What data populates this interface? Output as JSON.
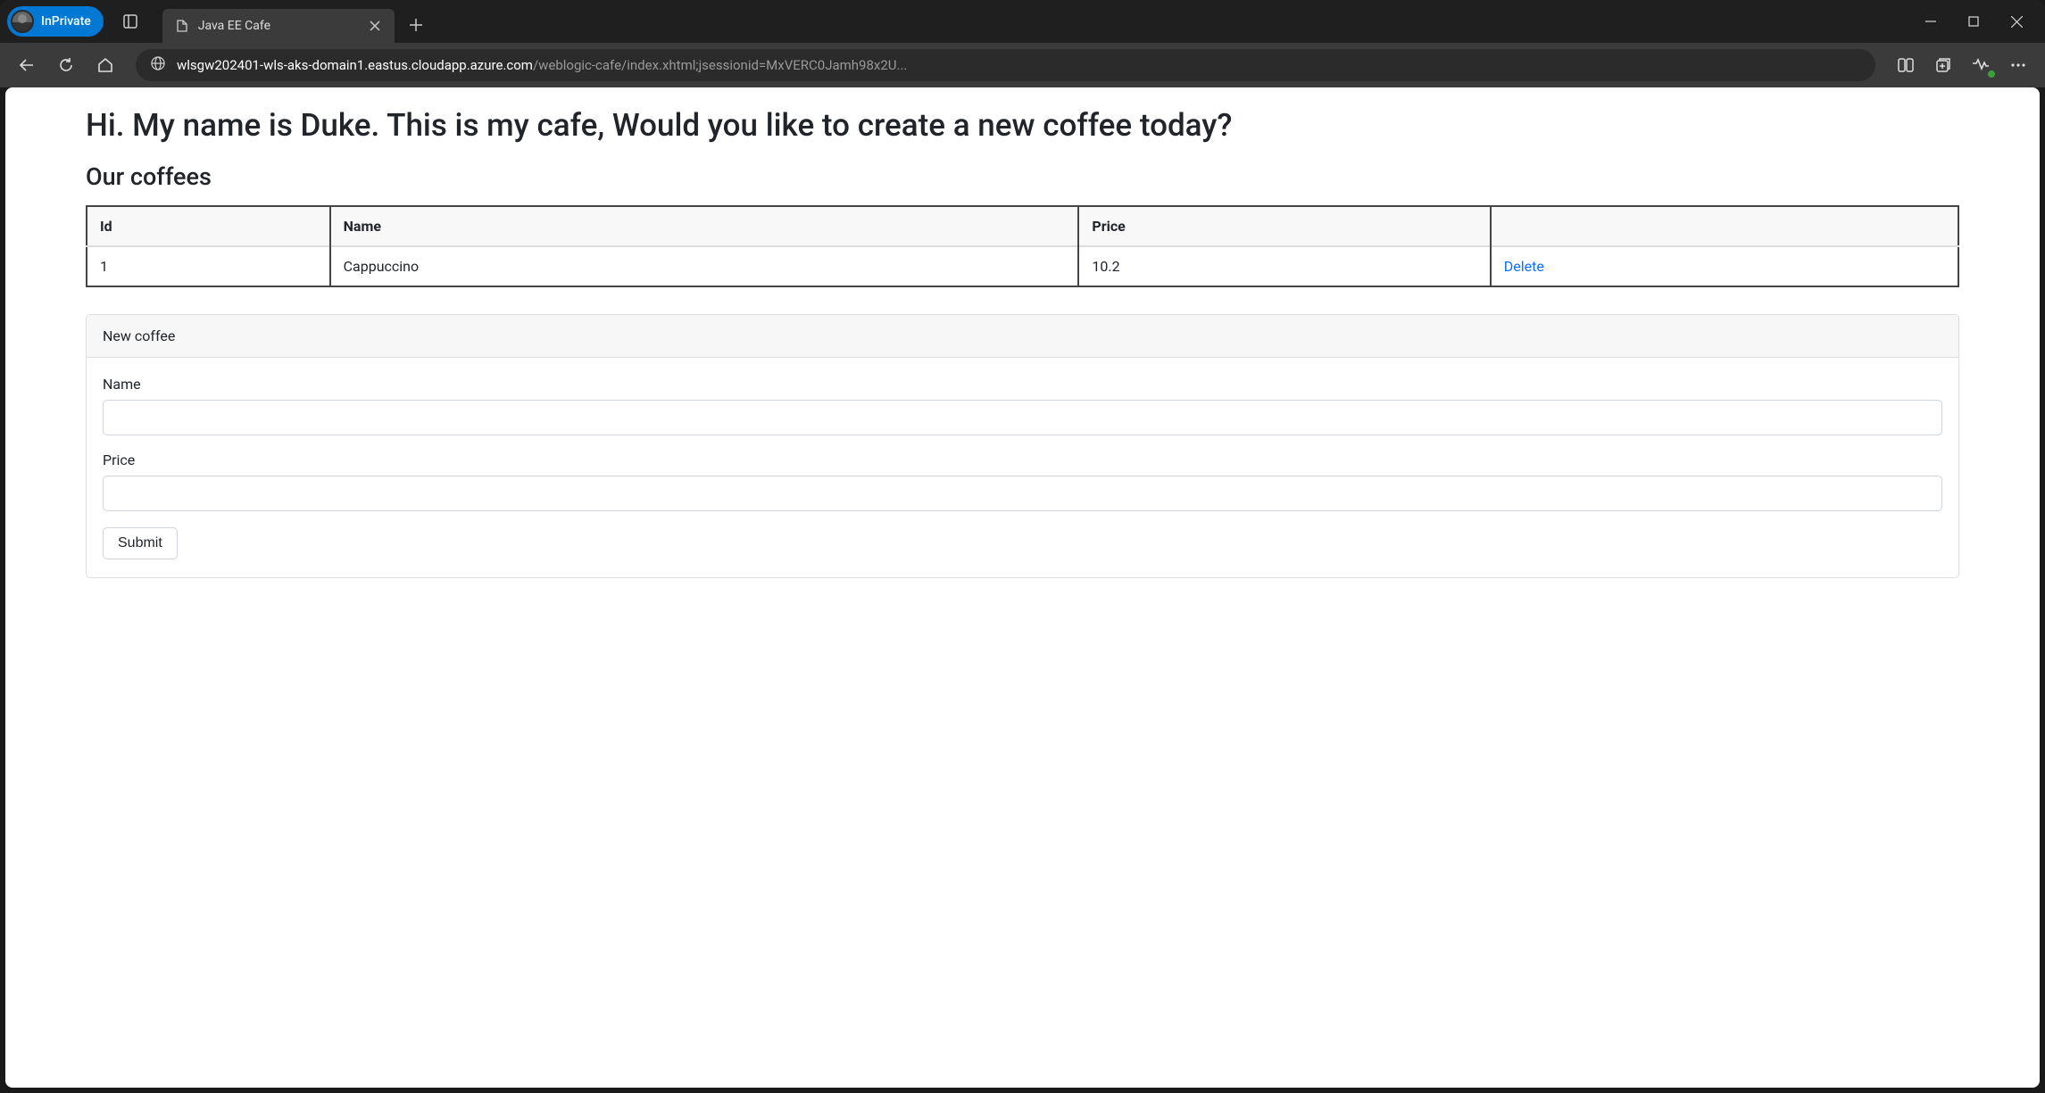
{
  "browser": {
    "inprivate_label": "InPrivate",
    "tab_title": "Java EE Cafe",
    "url_host": "wlsgw202401-wls-aks-domain1.eastus.cloudapp.azure.com",
    "url_path": "/weblogic-cafe/index.xhtml;jsessionid=MxVERC0Jamh98x2U..."
  },
  "page": {
    "heading": "Hi. My name is Duke. This is my cafe, Would you like to create a new coffee today?",
    "section_title": "Our coffees",
    "table": {
      "headers": {
        "id": "Id",
        "name": "Name",
        "price": "Price",
        "actions": ""
      },
      "rows": [
        {
          "id": "1",
          "name": "Cappuccino",
          "price": "10.2",
          "action": "Delete"
        }
      ]
    },
    "form": {
      "panel_title": "New coffee",
      "name_label": "Name",
      "name_value": "",
      "price_label": "Price",
      "price_value": "",
      "submit_label": "Submit"
    }
  }
}
